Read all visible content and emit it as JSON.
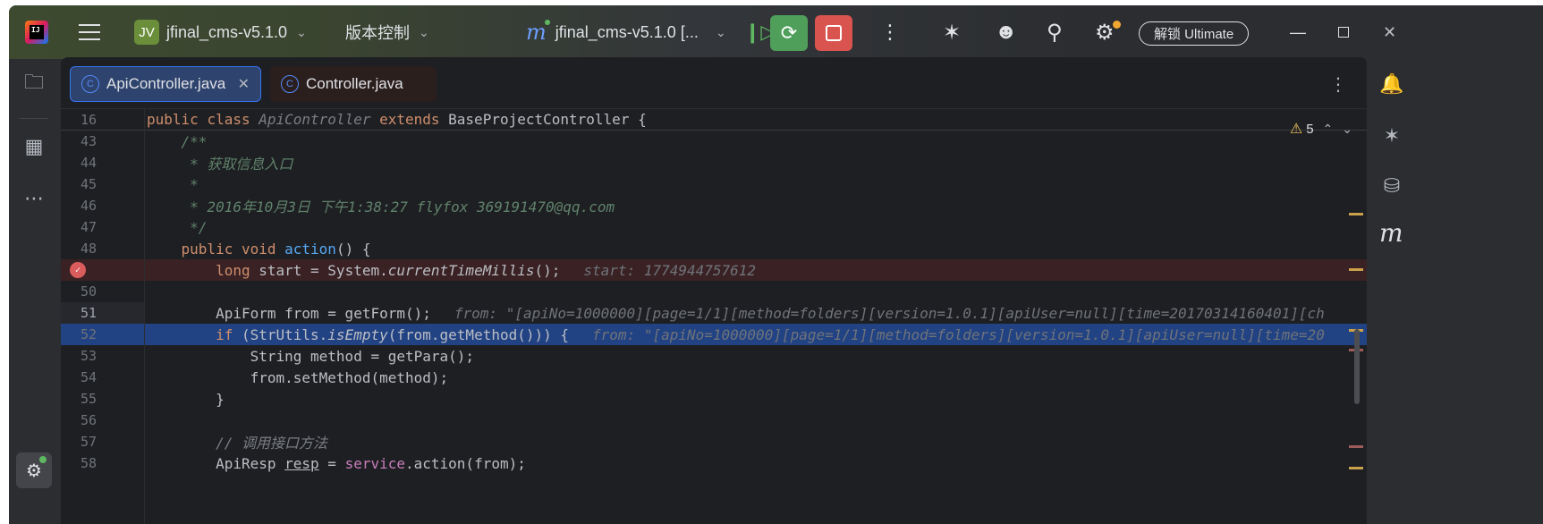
{
  "title_bar": {
    "logo_text": "IJ",
    "project_badge": "JV",
    "project_name": "jfinal_cms-v5.1.0",
    "vcs_label": "版本控制",
    "run_config": "jfinal_cms-v5.1.0 [...",
    "unlock_label": "解锁 Ultimate",
    "icons": [
      "menu-icon",
      "resume-icon",
      "debug-rerun-icon",
      "stop-icon",
      "more-icon",
      "ai-assistant-icon",
      "add-user-icon",
      "search-icon",
      "settings-icon"
    ]
  },
  "tabs": [
    {
      "label": "ApiController.java",
      "active": true
    },
    {
      "label": "Controller.java",
      "active": false
    }
  ],
  "editor": {
    "warnings_count": "5",
    "sticky_line": {
      "num": "16",
      "parts": [
        {
          "t": "public ",
          "c": "k"
        },
        {
          "t": "class ",
          "c": "k"
        },
        {
          "t": "ApiController ",
          "c": "cmtgray"
        },
        {
          "t": "extends ",
          "c": "k"
        },
        {
          "t": "BaseProjectController {",
          "c": "cls"
        }
      ]
    },
    "lines": [
      {
        "num": "43",
        "parts": [
          {
            "t": "    /**",
            "c": "doc"
          }
        ]
      },
      {
        "num": "44",
        "parts": [
          {
            "t": "     * 获取信息入口",
            "c": "doc"
          }
        ]
      },
      {
        "num": "45",
        "parts": [
          {
            "t": "     *",
            "c": "doc"
          }
        ]
      },
      {
        "num": "46",
        "parts": [
          {
            "t": "     * 2016年10月3日 下午1:38:27 flyfox 369191470@qq.com",
            "c": "doc"
          }
        ]
      },
      {
        "num": "47",
        "parts": [
          {
            "t": "     */",
            "c": "doc"
          }
        ]
      },
      {
        "num": "48",
        "parts": [
          {
            "t": "    public ",
            "c": "k"
          },
          {
            "t": "void ",
            "c": "k"
          },
          {
            "t": "action",
            "c": "fn"
          },
          {
            "t": "() {",
            "c": "cls"
          }
        ]
      },
      {
        "num": "",
        "breakpoint": true,
        "parts": [
          {
            "t": "        long ",
            "c": "k"
          },
          {
            "t": "start = System.",
            "c": "cls"
          },
          {
            "t": "currentTimeMillis",
            "c": "it"
          },
          {
            "t": "();",
            "c": "cls"
          },
          {
            "t": "start: 1774944757612",
            "c": "inlay"
          }
        ]
      },
      {
        "num": "50",
        "parts": []
      },
      {
        "num": "51",
        "current": true,
        "parts": [
          {
            "t": "        ApiForm from = getForm();",
            "c": "cls"
          },
          {
            "t": "from: \"[apiNo=1000000][page=1/1][method=folders][version=1.0.1][apiUser=null][time=20170314160401][ch",
            "c": "inlay"
          }
        ]
      },
      {
        "num": "52",
        "selected": true,
        "parts": [
          {
            "t": "        if ",
            "c": "k"
          },
          {
            "t": "(StrUtils.",
            "c": "cls"
          },
          {
            "t": "isEmpty",
            "c": "it"
          },
          {
            "t": "(from.getMethod())) {",
            "c": "cls"
          },
          {
            "t": "from: \"[apiNo=1000000][page=1/1][method=folders][version=1.0.1][apiUser=null][time=20",
            "c": "inlay"
          }
        ]
      },
      {
        "num": "53",
        "parts": [
          {
            "t": "            String method = getPara();",
            "c": "cls"
          }
        ]
      },
      {
        "num": "54",
        "parts": [
          {
            "t": "            from.setMethod(method);",
            "c": "cls"
          }
        ]
      },
      {
        "num": "55",
        "parts": [
          {
            "t": "        }",
            "c": "cls"
          }
        ]
      },
      {
        "num": "56",
        "parts": []
      },
      {
        "num": "57",
        "parts": [
          {
            "t": "        // 调用接口方法",
            "c": "cmt"
          }
        ]
      },
      {
        "num": "58",
        "parts": [
          {
            "t": "        ApiResp ",
            "c": "cls"
          },
          {
            "t": "resp",
            "c": "u"
          },
          {
            "t": " = ",
            "c": "cls"
          },
          {
            "t": "service",
            "c": "field"
          },
          {
            "t": ".action(from);",
            "c": "cls"
          }
        ]
      }
    ]
  },
  "colors": {
    "keyword": "#cf8e6d",
    "doc_comment": "#5f826b",
    "function": "#56a8f5",
    "selection": "#214283",
    "breakpoint_row": "#3a2224",
    "accent": "#3574f0"
  }
}
